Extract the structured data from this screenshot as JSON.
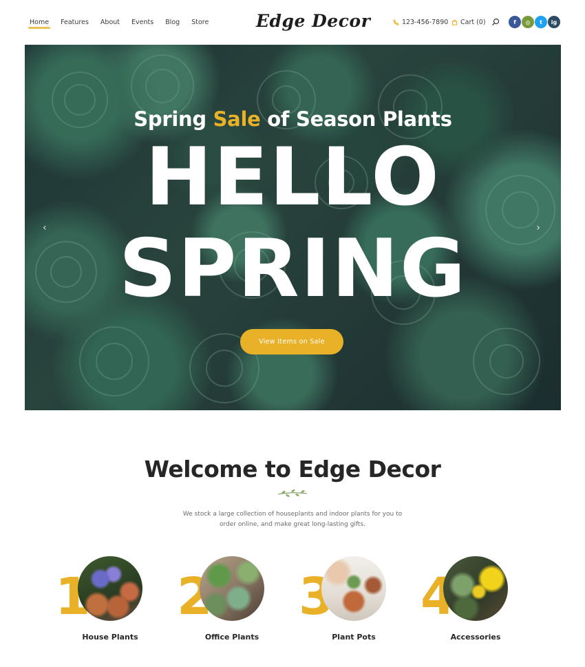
{
  "header": {
    "nav": [
      "Home",
      "Features",
      "About",
      "Events",
      "Blog",
      "Store"
    ],
    "logo": "Edge Decor",
    "phone": "123-456-7890",
    "cart": "Cart (0)",
    "socials": [
      "f",
      "◎",
      "t",
      "ig"
    ]
  },
  "hero": {
    "sub_prefix": "Spring ",
    "sub_highlight": "Sale",
    "sub_suffix": " of Season Plants",
    "line1": "HELLO",
    "line2": "SPRING",
    "button": "View Items on Sale",
    "prev_arrow": "‹",
    "next_arrow": "›"
  },
  "welcome": {
    "title": "Welcome to Edge Decor",
    "text": "We stock a large collection of houseplants and indoor plants for you to order online, and make great long-lasting gifts."
  },
  "categories": [
    {
      "num": "1",
      "label": "House Plants"
    },
    {
      "num": "2",
      "label": "Office Plants"
    },
    {
      "num": "3",
      "label": "Plant Pots"
    },
    {
      "num": "4",
      "label": "Accessories"
    }
  ],
  "colors": {
    "accent": "#e8b128",
    "text": "#262626",
    "facebook": "#3b5998",
    "pinterest": "#7a9a3a",
    "twitter": "#1da1f2",
    "instagram": "#2d4a63"
  }
}
